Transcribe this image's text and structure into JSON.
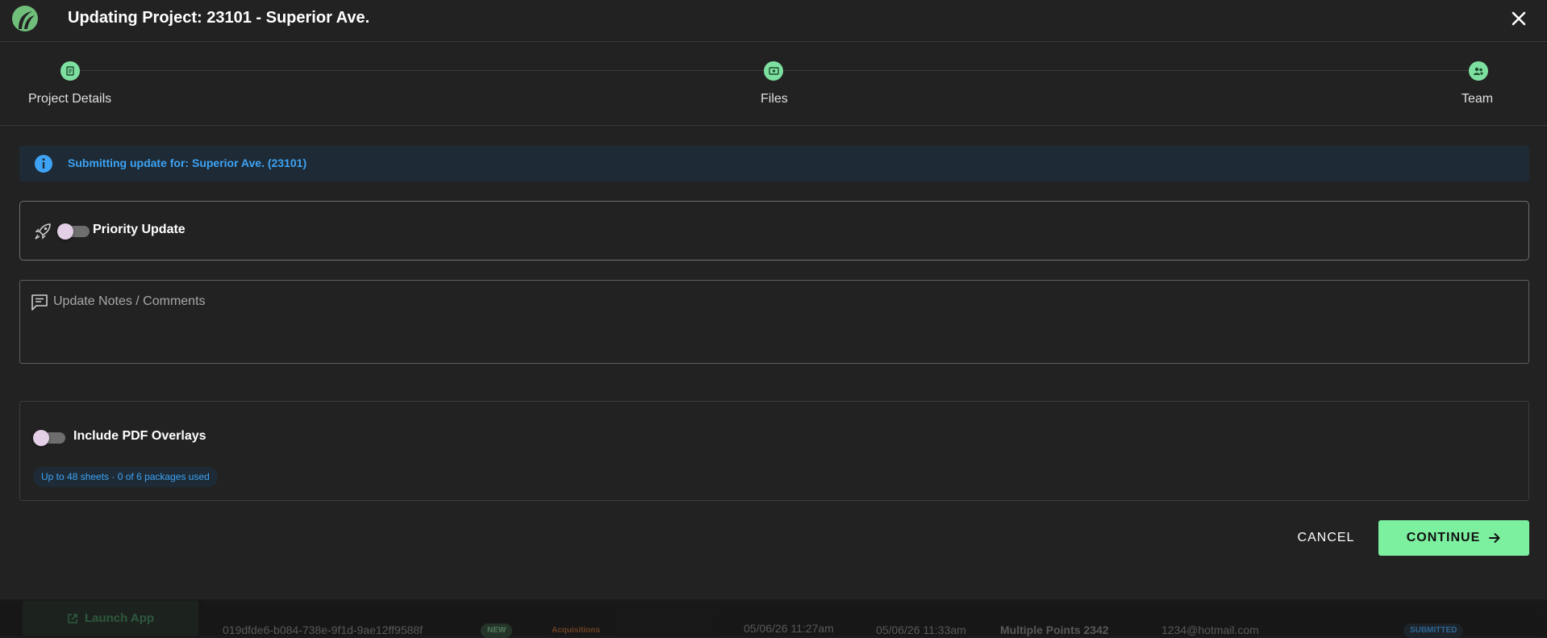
{
  "header": {
    "title": "Updating Project: 23101 - Superior Ave."
  },
  "steps": [
    {
      "label": "Project Details",
      "icon": "document-icon"
    },
    {
      "label": "Files",
      "icon": "folder-icon"
    },
    {
      "label": "Team",
      "icon": "team-icon"
    }
  ],
  "info_banner": {
    "text": "Submitting update for: Superior Ave. (23101)"
  },
  "priority": {
    "label": "Priority Update",
    "enabled": false
  },
  "notes": {
    "placeholder": "Update Notes / Comments"
  },
  "pdf_overlays": {
    "label": "Include PDF Overlays",
    "enabled": false,
    "usage": "Up to 48 sheets · 0 of 6 packages used"
  },
  "actions": {
    "cancel_label": "CANCEL",
    "continue_label": "CONTINUE"
  },
  "background_row": {
    "launch_label": "Launch App",
    "id": "019dfde6-b084-738e-9f1d-9ae12ff9588f",
    "badge_new": "NEW",
    "badge_type": "Acquisitions",
    "created": "05/06/26 11:27am",
    "updated": "05/06/26 11:33am",
    "project": "Multiple Points 2342",
    "email": "1234@hotmail.com",
    "status": "SUBMITTED"
  },
  "colors": {
    "accent": "#7df0a0",
    "info_text": "#3ea3f5",
    "info_bg": "#1e2b36",
    "surface": "#222222"
  }
}
